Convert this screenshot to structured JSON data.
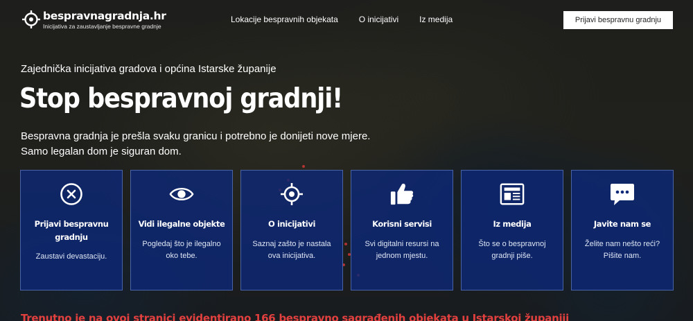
{
  "header": {
    "logo_title": "bespravnagradnja.hr",
    "logo_subtitle": "Inicijativa za zaustavljanje bespravne gradnje",
    "nav": [
      {
        "label": "Lokacije bespravnih objekata"
      },
      {
        "label": "O inicijativi"
      },
      {
        "label": "Iz medija"
      }
    ],
    "report_button": "Prijavi bespravnu gradnju"
  },
  "hero": {
    "kicker": "Zajednička inicijativa gradova i općina Istarske županije",
    "title": "Stop bespravnoj gradnji!",
    "desc_line1": "Bespravna gradnja je prešla svaku granicu i potrebno je donijeti nove mjere.",
    "desc_line2": "Samo legalan dom je siguran dom."
  },
  "cards": [
    {
      "icon": "close-circle-icon",
      "title": "Prijavi bespravnu gradnju",
      "text": "Zaustavi devastaciju."
    },
    {
      "icon": "eye-icon",
      "title": "Vidi ilegalne objekte",
      "text": "Pogledaj što je ilegalno oko tebe."
    },
    {
      "icon": "target-icon",
      "title": "O inicijativi",
      "text": "Saznaj zašto je nastala ova inicijativa."
    },
    {
      "icon": "thumbs-up-icon",
      "title": "Korisni servisi",
      "text": "Svi digitalni resursi na jednom mjestu."
    },
    {
      "icon": "newspaper-icon",
      "title": "Iz medija",
      "text": "Što se o bespravnoj gradnji piše."
    },
    {
      "icon": "chat-bubble-icon",
      "title": "Javite nam se",
      "text": "Želite nam nešto reći? Pišite nam."
    }
  ],
  "counter_text": "Trenutno je na ovoj stranici evidentirano 166 bespravno sagrađenih objekata u Istarskoj županiji",
  "colors": {
    "card_bg": "#0c2878",
    "counter": "#e2403f",
    "button_bg": "#ffffff"
  }
}
